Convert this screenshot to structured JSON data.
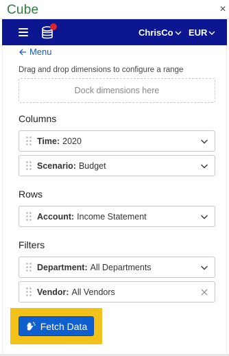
{
  "app": {
    "title": "Cube",
    "close_glyph": "✕"
  },
  "navbar": {
    "user": "ChrisCo",
    "currency": "EUR"
  },
  "panel": {
    "back_label": "Menu",
    "hint": "Drag and drop dimensions to configure a range",
    "dock_placeholder": "Dock dimensions here"
  },
  "columns": {
    "title": "Columns",
    "items": [
      {
        "name": "Time:",
        "value": "2020"
      },
      {
        "name": "Scenario:",
        "value": "Budget"
      }
    ]
  },
  "rows": {
    "title": "Rows",
    "items": [
      {
        "name": "Account:",
        "value": "Income Statement"
      }
    ]
  },
  "filters": {
    "title": "Filters",
    "items": [
      {
        "name": "Department:",
        "value": "All Departments"
      },
      {
        "name": "Vendor:",
        "value": "All Vendors"
      }
    ]
  },
  "actions": {
    "fetch_label": "Fetch Data"
  },
  "colors": {
    "navbar": "#0b1690",
    "accent_button": "#0f5fce",
    "highlight": "#f2c21b",
    "title_green": "#2f7d3e",
    "notification_dot": "#e0242c"
  }
}
